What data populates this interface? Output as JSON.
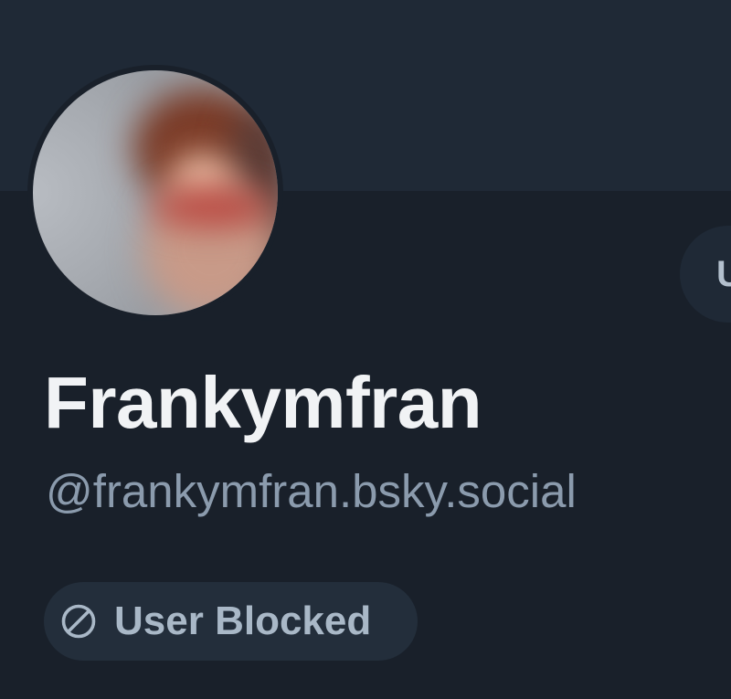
{
  "profile": {
    "display_name": "Frankymfran",
    "handle": "@frankymfran.bsky.social",
    "avatar_icon": "avatar-photo",
    "status_badge": {
      "label": "User Blocked",
      "icon": "block-icon"
    }
  },
  "actions": {
    "edge_button_label": "U"
  },
  "colors": {
    "background": "#19202a",
    "banner": "#1f2936",
    "name_text": "#f1f3f5",
    "handle_text": "#8b9bad",
    "badge_bg": "#232e3b",
    "badge_text": "#a9b8c7"
  }
}
